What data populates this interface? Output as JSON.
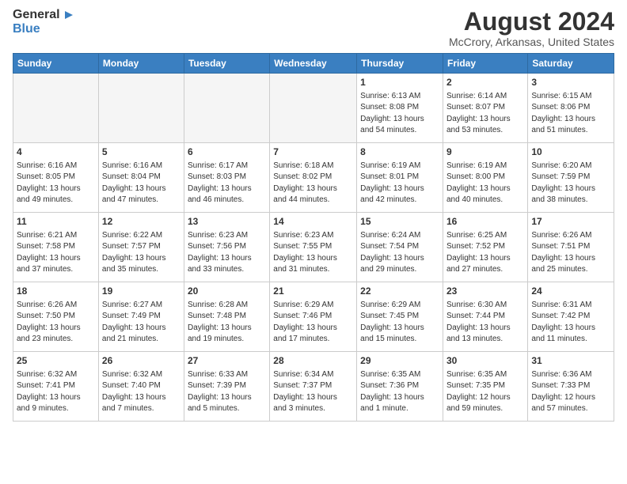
{
  "header": {
    "logo_general": "General",
    "logo_blue": "Blue",
    "title": "August 2024",
    "subtitle": "McCrory, Arkansas, United States"
  },
  "weekdays": [
    "Sunday",
    "Monday",
    "Tuesday",
    "Wednesday",
    "Thursday",
    "Friday",
    "Saturday"
  ],
  "weeks": [
    [
      {
        "day": "",
        "info": ""
      },
      {
        "day": "",
        "info": ""
      },
      {
        "day": "",
        "info": ""
      },
      {
        "day": "",
        "info": ""
      },
      {
        "day": "1",
        "info": "Sunrise: 6:13 AM\nSunset: 8:08 PM\nDaylight: 13 hours\nand 54 minutes."
      },
      {
        "day": "2",
        "info": "Sunrise: 6:14 AM\nSunset: 8:07 PM\nDaylight: 13 hours\nand 53 minutes."
      },
      {
        "day": "3",
        "info": "Sunrise: 6:15 AM\nSunset: 8:06 PM\nDaylight: 13 hours\nand 51 minutes."
      }
    ],
    [
      {
        "day": "4",
        "info": "Sunrise: 6:16 AM\nSunset: 8:05 PM\nDaylight: 13 hours\nand 49 minutes."
      },
      {
        "day": "5",
        "info": "Sunrise: 6:16 AM\nSunset: 8:04 PM\nDaylight: 13 hours\nand 47 minutes."
      },
      {
        "day": "6",
        "info": "Sunrise: 6:17 AM\nSunset: 8:03 PM\nDaylight: 13 hours\nand 46 minutes."
      },
      {
        "day": "7",
        "info": "Sunrise: 6:18 AM\nSunset: 8:02 PM\nDaylight: 13 hours\nand 44 minutes."
      },
      {
        "day": "8",
        "info": "Sunrise: 6:19 AM\nSunset: 8:01 PM\nDaylight: 13 hours\nand 42 minutes."
      },
      {
        "day": "9",
        "info": "Sunrise: 6:19 AM\nSunset: 8:00 PM\nDaylight: 13 hours\nand 40 minutes."
      },
      {
        "day": "10",
        "info": "Sunrise: 6:20 AM\nSunset: 7:59 PM\nDaylight: 13 hours\nand 38 minutes."
      }
    ],
    [
      {
        "day": "11",
        "info": "Sunrise: 6:21 AM\nSunset: 7:58 PM\nDaylight: 13 hours\nand 37 minutes."
      },
      {
        "day": "12",
        "info": "Sunrise: 6:22 AM\nSunset: 7:57 PM\nDaylight: 13 hours\nand 35 minutes."
      },
      {
        "day": "13",
        "info": "Sunrise: 6:23 AM\nSunset: 7:56 PM\nDaylight: 13 hours\nand 33 minutes."
      },
      {
        "day": "14",
        "info": "Sunrise: 6:23 AM\nSunset: 7:55 PM\nDaylight: 13 hours\nand 31 minutes."
      },
      {
        "day": "15",
        "info": "Sunrise: 6:24 AM\nSunset: 7:54 PM\nDaylight: 13 hours\nand 29 minutes."
      },
      {
        "day": "16",
        "info": "Sunrise: 6:25 AM\nSunset: 7:52 PM\nDaylight: 13 hours\nand 27 minutes."
      },
      {
        "day": "17",
        "info": "Sunrise: 6:26 AM\nSunset: 7:51 PM\nDaylight: 13 hours\nand 25 minutes."
      }
    ],
    [
      {
        "day": "18",
        "info": "Sunrise: 6:26 AM\nSunset: 7:50 PM\nDaylight: 13 hours\nand 23 minutes."
      },
      {
        "day": "19",
        "info": "Sunrise: 6:27 AM\nSunset: 7:49 PM\nDaylight: 13 hours\nand 21 minutes."
      },
      {
        "day": "20",
        "info": "Sunrise: 6:28 AM\nSunset: 7:48 PM\nDaylight: 13 hours\nand 19 minutes."
      },
      {
        "day": "21",
        "info": "Sunrise: 6:29 AM\nSunset: 7:46 PM\nDaylight: 13 hours\nand 17 minutes."
      },
      {
        "day": "22",
        "info": "Sunrise: 6:29 AM\nSunset: 7:45 PM\nDaylight: 13 hours\nand 15 minutes."
      },
      {
        "day": "23",
        "info": "Sunrise: 6:30 AM\nSunset: 7:44 PM\nDaylight: 13 hours\nand 13 minutes."
      },
      {
        "day": "24",
        "info": "Sunrise: 6:31 AM\nSunset: 7:42 PM\nDaylight: 13 hours\nand 11 minutes."
      }
    ],
    [
      {
        "day": "25",
        "info": "Sunrise: 6:32 AM\nSunset: 7:41 PM\nDaylight: 13 hours\nand 9 minutes."
      },
      {
        "day": "26",
        "info": "Sunrise: 6:32 AM\nSunset: 7:40 PM\nDaylight: 13 hours\nand 7 minutes."
      },
      {
        "day": "27",
        "info": "Sunrise: 6:33 AM\nSunset: 7:39 PM\nDaylight: 13 hours\nand 5 minutes."
      },
      {
        "day": "28",
        "info": "Sunrise: 6:34 AM\nSunset: 7:37 PM\nDaylight: 13 hours\nand 3 minutes."
      },
      {
        "day": "29",
        "info": "Sunrise: 6:35 AM\nSunset: 7:36 PM\nDaylight: 13 hours\nand 1 minute."
      },
      {
        "day": "30",
        "info": "Sunrise: 6:35 AM\nSunset: 7:35 PM\nDaylight: 12 hours\nand 59 minutes."
      },
      {
        "day": "31",
        "info": "Sunrise: 6:36 AM\nSunset: 7:33 PM\nDaylight: 12 hours\nand 57 minutes."
      }
    ]
  ]
}
